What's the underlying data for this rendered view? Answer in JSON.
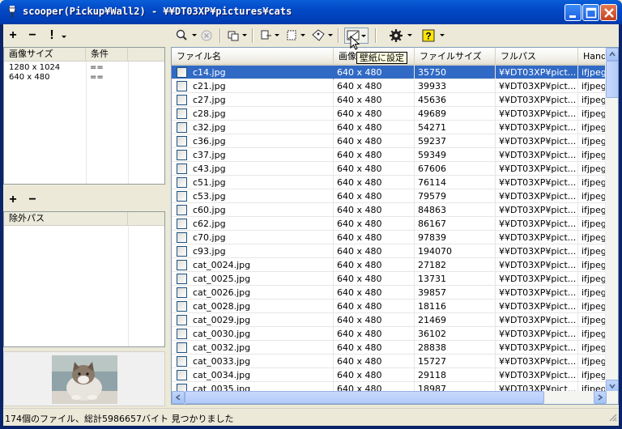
{
  "window": {
    "title": "scooper(Pickup¥Wall2) - ¥¥DT03XP¥pictures¥cats"
  },
  "left_top": {
    "toolbar": [
      "+",
      "−",
      "!"
    ],
    "columns": [
      "画像サイズ",
      "条件"
    ],
    "rows": [
      [
        "1280 x 1024",
        "=="
      ],
      [
        "640 x 480",
        "=="
      ]
    ]
  },
  "left_mid": {
    "toolbar": [
      "+",
      "−"
    ],
    "columns": [
      "除外パス"
    ]
  },
  "toolbar": {
    "icons": [
      "search-icon",
      "stop-icon",
      "copy-icon",
      "move-icon",
      "delete-icon",
      "tag-icon",
      "wallpaper-icon",
      "settings-icon",
      "help-icon"
    ],
    "tooltip": "壁紙に設定"
  },
  "list": {
    "columns": [
      "ファイル名",
      "画像サイズ",
      "ファイルサイズ",
      "フルパス",
      "Hand"
    ],
    "rows": [
      {
        "name": "c14.jpg",
        "dim": "640 x 480",
        "size": "35750",
        "path": "¥¥DT03XP¥pict...",
        "handler": "ifjpeg",
        "selected": true
      },
      {
        "name": "c21.jpg",
        "dim": "640 x 480",
        "size": "39933",
        "path": "¥¥DT03XP¥pict...",
        "handler": "ifjpeg"
      },
      {
        "name": "c27.jpg",
        "dim": "640 x 480",
        "size": "45636",
        "path": "¥¥DT03XP¥pict...",
        "handler": "ifjpeg"
      },
      {
        "name": "c28.jpg",
        "dim": "640 x 480",
        "size": "49689",
        "path": "¥¥DT03XP¥pict...",
        "handler": "ifjpeg"
      },
      {
        "name": "c32.jpg",
        "dim": "640 x 480",
        "size": "54271",
        "path": "¥¥DT03XP¥pict...",
        "handler": "ifjpeg"
      },
      {
        "name": "c36.jpg",
        "dim": "640 x 480",
        "size": "59237",
        "path": "¥¥DT03XP¥pict...",
        "handler": "ifjpeg"
      },
      {
        "name": "c37.jpg",
        "dim": "640 x 480",
        "size": "59349",
        "path": "¥¥DT03XP¥pict...",
        "handler": "ifjpeg"
      },
      {
        "name": "c43.jpg",
        "dim": "640 x 480",
        "size": "67606",
        "path": "¥¥DT03XP¥pict...",
        "handler": "ifjpeg"
      },
      {
        "name": "c51.jpg",
        "dim": "640 x 480",
        "size": "76114",
        "path": "¥¥DT03XP¥pict...",
        "handler": "ifjpeg"
      },
      {
        "name": "c53.jpg",
        "dim": "640 x 480",
        "size": "79579",
        "path": "¥¥DT03XP¥pict...",
        "handler": "ifjpeg"
      },
      {
        "name": "c60.jpg",
        "dim": "640 x 480",
        "size": "84863",
        "path": "¥¥DT03XP¥pict...",
        "handler": "ifjpeg"
      },
      {
        "name": "c62.jpg",
        "dim": "640 x 480",
        "size": "86167",
        "path": "¥¥DT03XP¥pict...",
        "handler": "ifjpeg"
      },
      {
        "name": "c70.jpg",
        "dim": "640 x 480",
        "size": "97839",
        "path": "¥¥DT03XP¥pict...",
        "handler": "ifjpeg"
      },
      {
        "name": "c93.jpg",
        "dim": "640 x 480",
        "size": "194070",
        "path": "¥¥DT03XP¥pict...",
        "handler": "ifjpeg"
      },
      {
        "name": "cat_0024.jpg",
        "dim": "640 x 480",
        "size": "27182",
        "path": "¥¥DT03XP¥pict...",
        "handler": "ifjpeg"
      },
      {
        "name": "cat_0025.jpg",
        "dim": "640 x 480",
        "size": "13731",
        "path": "¥¥DT03XP¥pict...",
        "handler": "ifjpeg"
      },
      {
        "name": "cat_0026.jpg",
        "dim": "640 x 480",
        "size": "39857",
        "path": "¥¥DT03XP¥pict...",
        "handler": "ifjpeg"
      },
      {
        "name": "cat_0028.jpg",
        "dim": "640 x 480",
        "size": "18116",
        "path": "¥¥DT03XP¥pict...",
        "handler": "ifjpeg"
      },
      {
        "name": "cat_0029.jpg",
        "dim": "640 x 480",
        "size": "21469",
        "path": "¥¥DT03XP¥pict...",
        "handler": "ifjpeg"
      },
      {
        "name": "cat_0030.jpg",
        "dim": "640 x 480",
        "size": "36102",
        "path": "¥¥DT03XP¥pict...",
        "handler": "ifjpeg"
      },
      {
        "name": "cat_0032.jpg",
        "dim": "640 x 480",
        "size": "28838",
        "path": "¥¥DT03XP¥pict...",
        "handler": "ifjpeg"
      },
      {
        "name": "cat_0033.jpg",
        "dim": "640 x 480",
        "size": "15727",
        "path": "¥¥DT03XP¥pict...",
        "handler": "ifjpeg"
      },
      {
        "name": "cat_0034.jpg",
        "dim": "640 x 480",
        "size": "29118",
        "path": "¥¥DT03XP¥pict...",
        "handler": "ifjpeg"
      },
      {
        "name": "cat_0035.jpg",
        "dim": "640 x 480",
        "size": "18987",
        "path": "¥¥DT03XP¥pict...",
        "handler": "ifjpeg"
      }
    ]
  },
  "status": {
    "text": "174個のファイル、総計5986657バイト 見つかりました"
  },
  "colors": {
    "selection": "#316ac5",
    "titlebar": "#0348c6"
  }
}
